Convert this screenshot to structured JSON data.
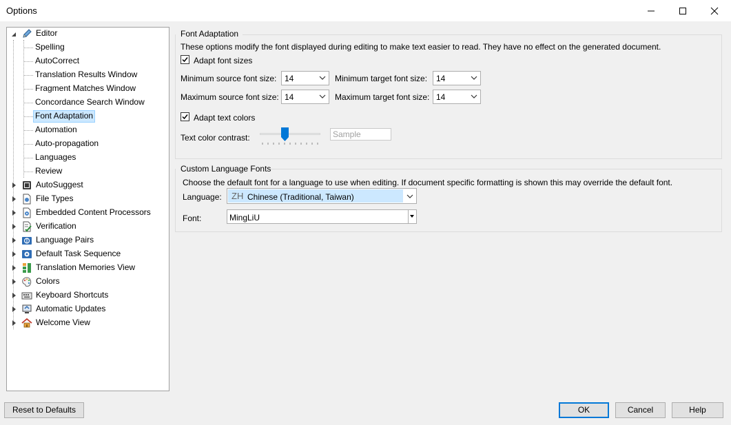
{
  "window": {
    "title": "Options"
  },
  "tree": {
    "root": {
      "label": "Editor",
      "icon": "pencil-icon"
    },
    "children": [
      {
        "label": "Spelling"
      },
      {
        "label": "AutoCorrect"
      },
      {
        "label": "Translation Results Window"
      },
      {
        "label": "Fragment Matches Window"
      },
      {
        "label": "Concordance Search Window"
      },
      {
        "label": "Font Adaptation",
        "selected": true
      },
      {
        "label": "Automation"
      },
      {
        "label": "Auto-propagation"
      },
      {
        "label": "Languages"
      },
      {
        "label": "Review"
      }
    ],
    "top_level": [
      {
        "label": "AutoSuggest",
        "icon": "autosuggest-icon"
      },
      {
        "label": "File Types",
        "icon": "file-types-icon"
      },
      {
        "label": "Embedded Content Processors",
        "icon": "embedded-content-icon"
      },
      {
        "label": "Verification",
        "icon": "verification-icon"
      },
      {
        "label": "Language Pairs",
        "icon": "language-pairs-icon"
      },
      {
        "label": "Default Task Sequence",
        "icon": "task-sequence-icon"
      },
      {
        "label": "Translation Memories View",
        "icon": "translation-memories-icon"
      },
      {
        "label": "Colors",
        "icon": "colors-palette-icon"
      },
      {
        "label": "Keyboard Shortcuts",
        "icon": "keyboard-icon"
      },
      {
        "label": "Automatic Updates",
        "icon": "updates-computer-icon"
      },
      {
        "label": "Welcome View",
        "icon": "home-icon"
      }
    ]
  },
  "font_adaptation": {
    "title": "Font Adaptation",
    "description": "These options modify the font displayed during editing to make text easier to read. They have no effect on the generated document.",
    "adapt_font_sizes": {
      "label": "Adapt font sizes",
      "checked": true
    },
    "min_source": {
      "label": "Minimum source font size:",
      "value": "14"
    },
    "min_target": {
      "label": "Minimum target font size:",
      "value": "14"
    },
    "max_source": {
      "label": "Maximum source font size:",
      "value": "14"
    },
    "max_target": {
      "label": "Maximum target font size:",
      "value": "14"
    },
    "adapt_text_colors": {
      "label": "Adapt text colors",
      "checked": true
    },
    "contrast": {
      "label": "Text color contrast:",
      "level": 0.4
    },
    "sample_placeholder": "Sample"
  },
  "custom_fonts": {
    "title": "Custom Language Fonts",
    "description": "Choose the default font for a language to use when editing. If document specific formatting is shown this may override the default font.",
    "language": {
      "label": "Language:",
      "code": "ZH",
      "value": "Chinese (Traditional, Taiwan)"
    },
    "font": {
      "label": "Font:",
      "value": "MingLiU"
    }
  },
  "buttons": {
    "reset": "Reset to Defaults",
    "ok": "OK",
    "cancel": "Cancel",
    "help": "Help"
  },
  "colors": {
    "selection_bg": "#cce8ff",
    "selection_border": "#99d1ff",
    "accent": "#0078d7"
  }
}
